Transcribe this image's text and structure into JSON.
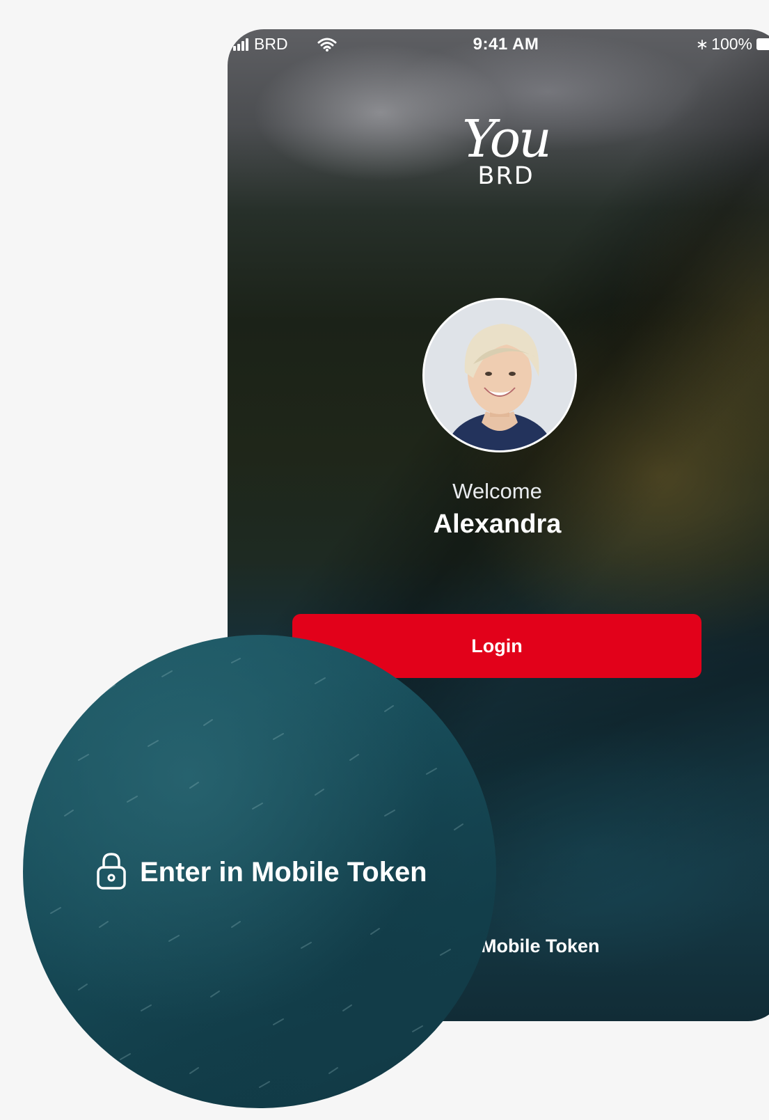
{
  "status_bar": {
    "carrier": "BRD",
    "time": "9:41 AM",
    "battery_percent": "100%"
  },
  "logo": {
    "primary": "You",
    "secondary": "BRD"
  },
  "greeting": {
    "welcome": "Welcome",
    "name": "Alexandra"
  },
  "actions": {
    "login_label": "Login",
    "mobile_token_partial": "n Mobile Token",
    "mobile_token_label": "Enter in Mobile Token"
  },
  "colors": {
    "accent": "#e2011a",
    "text": "#ffffff",
    "page_background": "#f6f6f6"
  },
  "icons": {
    "lock": "lock-icon",
    "wifi": "wifi-icon",
    "bluetooth": "bluetooth-icon"
  }
}
